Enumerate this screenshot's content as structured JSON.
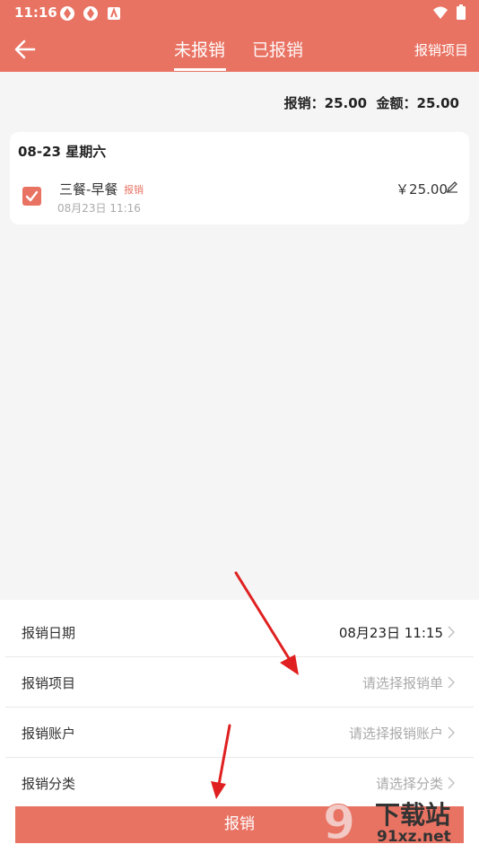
{
  "status_bar": {
    "time": "11:16",
    "icons": [
      "app-notification-icon",
      "app-notification-icon",
      "android-icon",
      "wifi-icon",
      "battery-icon"
    ]
  },
  "header": {
    "back_icon": "arrow-left-icon",
    "tabs": [
      {
        "label": "未报销",
        "active": true
      },
      {
        "label": "已报销",
        "active": false
      }
    ],
    "right_action": "报销项目"
  },
  "summary": {
    "text": "报销：25.00  金额：25.00"
  },
  "record_group": {
    "date_label": "08-23 星期六",
    "items": [
      {
        "name": "三餐-早餐",
        "tag": "报销",
        "time": "08月23日 11:16",
        "amount": "￥25.00",
        "checked": true
      }
    ]
  },
  "form": {
    "rows": [
      {
        "label": "报销日期",
        "value": "08月23日 11:15",
        "is_placeholder": false
      },
      {
        "label": "报销项目",
        "value": "请选择报销单",
        "is_placeholder": true
      },
      {
        "label": "报销账户",
        "value": "请选择报销账户",
        "is_placeholder": true
      },
      {
        "label": "报销分类",
        "value": "请选择分类",
        "is_placeholder": true
      }
    ],
    "submit_label": "报销"
  },
  "watermark": {
    "main": "下载站",
    "site": "91xz.net"
  },
  "colors": {
    "accent": "#e97363",
    "annotation_arrow": "#e02020"
  }
}
